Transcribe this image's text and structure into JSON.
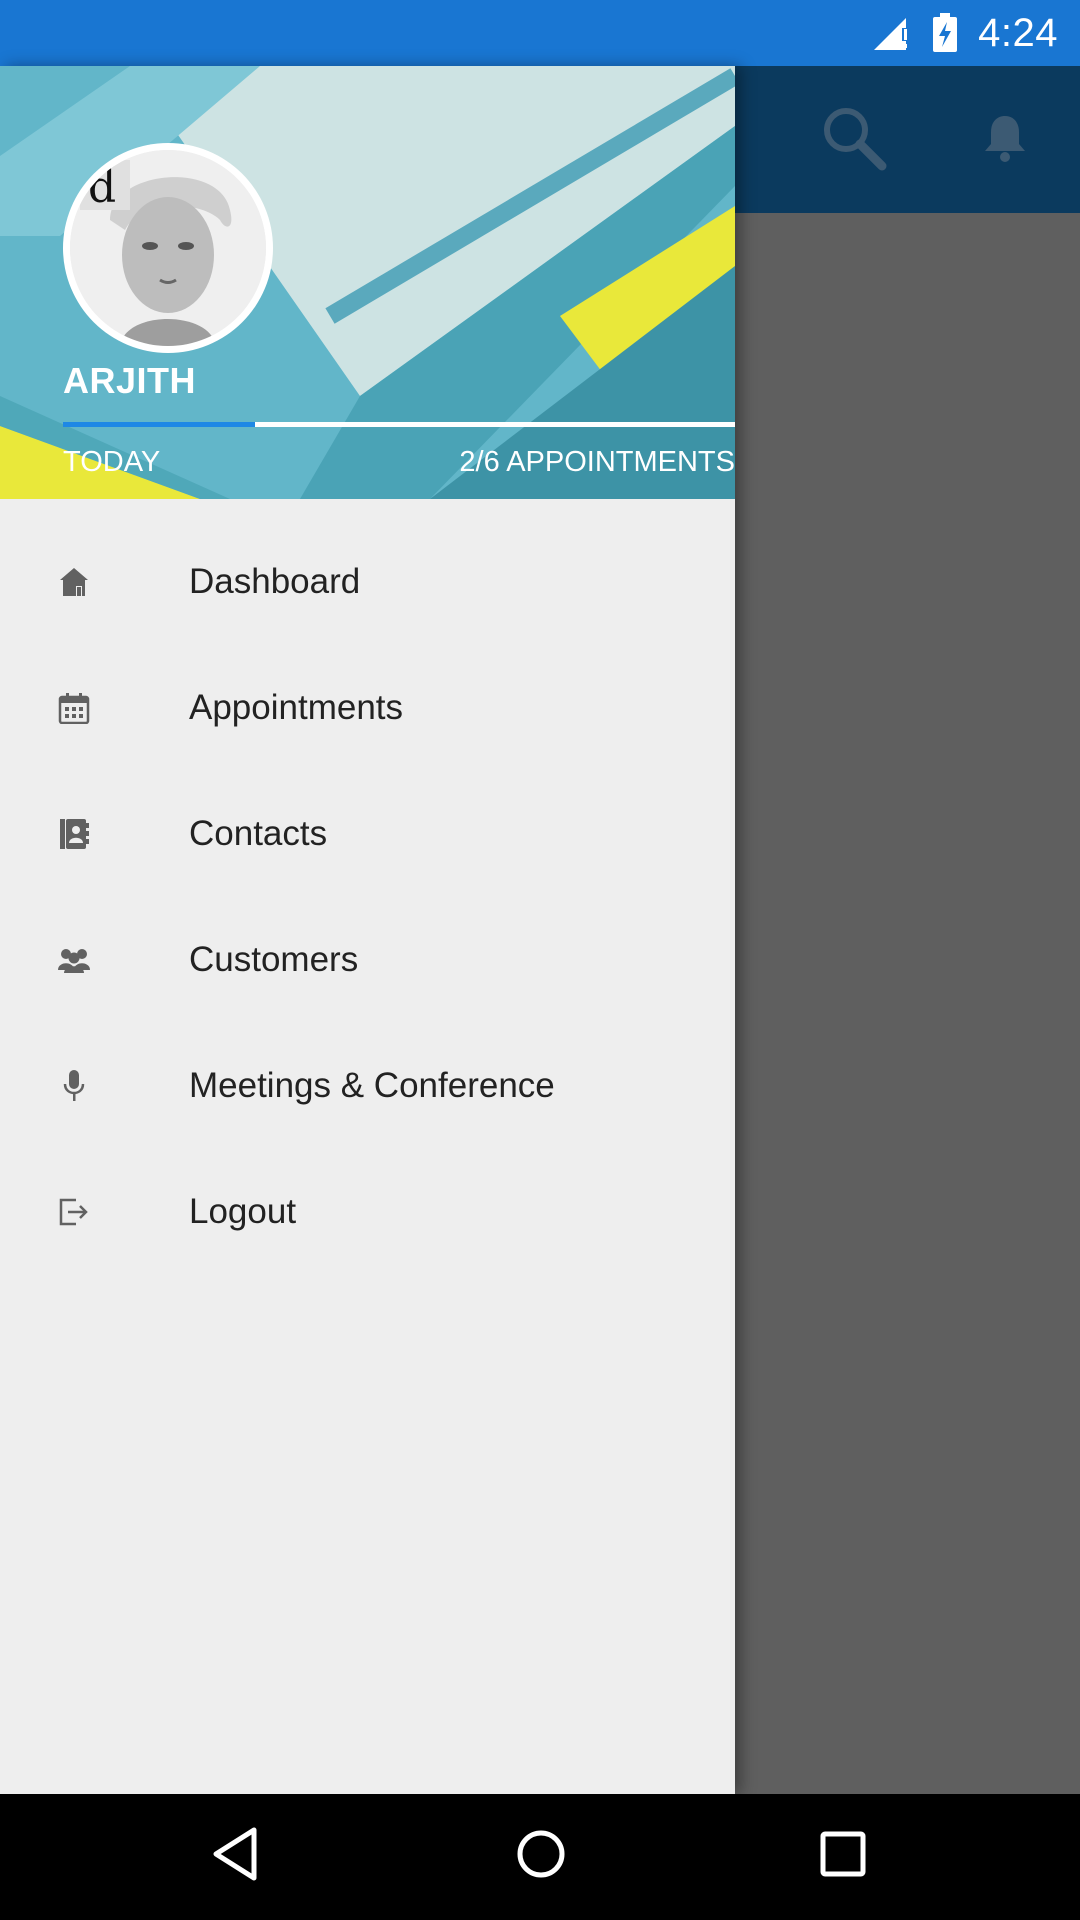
{
  "status_bar": {
    "time": "4:24",
    "icons": [
      "signal-alert-icon",
      "battery-charging-icon"
    ],
    "color": "#1976d2"
  },
  "toolbar": {
    "icons": [
      "search-icon",
      "bell-icon"
    ],
    "color": "#0b3a5e"
  },
  "drawer": {
    "header": {
      "user_name": "ARJITH",
      "today_label": "TODAY",
      "appointments_label": "2/6 APPOINTMENTS",
      "progress": 0.2857,
      "accent": "#1e88e5"
    },
    "menu": [
      {
        "label": "Dashboard",
        "icon": "home-icon"
      },
      {
        "label": "Appointments",
        "icon": "calendar-icon"
      },
      {
        "label": "Contacts",
        "icon": "contacts-book-icon"
      },
      {
        "label": "Customers",
        "icon": "people-group-icon"
      },
      {
        "label": "Meetings & Conference",
        "icon": "microphone-icon"
      },
      {
        "label": "Logout",
        "icon": "logout-icon"
      }
    ]
  },
  "nav_bar": {
    "buttons": [
      "back-icon",
      "home-circle-icon",
      "recents-square-icon"
    ]
  }
}
